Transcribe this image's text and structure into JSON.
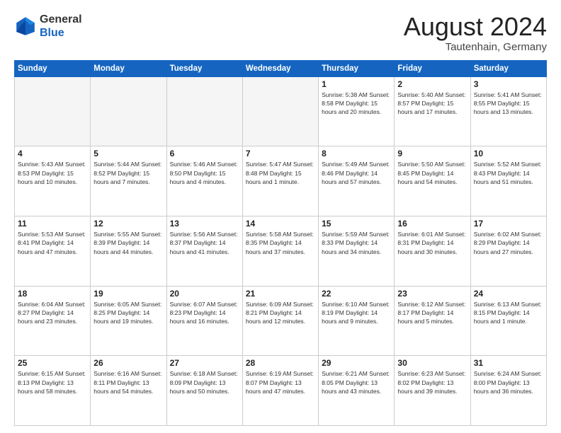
{
  "header": {
    "logo_general": "General",
    "logo_blue": "Blue",
    "title": "August 2024",
    "location": "Tautenhain, Germany"
  },
  "days_of_week": [
    "Sunday",
    "Monday",
    "Tuesday",
    "Wednesday",
    "Thursday",
    "Friday",
    "Saturday"
  ],
  "weeks": [
    [
      {
        "day": "",
        "info": ""
      },
      {
        "day": "",
        "info": ""
      },
      {
        "day": "",
        "info": ""
      },
      {
        "day": "",
        "info": ""
      },
      {
        "day": "1",
        "info": "Sunrise: 5:38 AM\nSunset: 8:58 PM\nDaylight: 15 hours\nand 20 minutes."
      },
      {
        "day": "2",
        "info": "Sunrise: 5:40 AM\nSunset: 8:57 PM\nDaylight: 15 hours\nand 17 minutes."
      },
      {
        "day": "3",
        "info": "Sunrise: 5:41 AM\nSunset: 8:55 PM\nDaylight: 15 hours\nand 13 minutes."
      }
    ],
    [
      {
        "day": "4",
        "info": "Sunrise: 5:43 AM\nSunset: 8:53 PM\nDaylight: 15 hours\nand 10 minutes."
      },
      {
        "day": "5",
        "info": "Sunrise: 5:44 AM\nSunset: 8:52 PM\nDaylight: 15 hours\nand 7 minutes."
      },
      {
        "day": "6",
        "info": "Sunrise: 5:46 AM\nSunset: 8:50 PM\nDaylight: 15 hours\nand 4 minutes."
      },
      {
        "day": "7",
        "info": "Sunrise: 5:47 AM\nSunset: 8:48 PM\nDaylight: 15 hours\nand 1 minute."
      },
      {
        "day": "8",
        "info": "Sunrise: 5:49 AM\nSunset: 8:46 PM\nDaylight: 14 hours\nand 57 minutes."
      },
      {
        "day": "9",
        "info": "Sunrise: 5:50 AM\nSunset: 8:45 PM\nDaylight: 14 hours\nand 54 minutes."
      },
      {
        "day": "10",
        "info": "Sunrise: 5:52 AM\nSunset: 8:43 PM\nDaylight: 14 hours\nand 51 minutes."
      }
    ],
    [
      {
        "day": "11",
        "info": "Sunrise: 5:53 AM\nSunset: 8:41 PM\nDaylight: 14 hours\nand 47 minutes."
      },
      {
        "day": "12",
        "info": "Sunrise: 5:55 AM\nSunset: 8:39 PM\nDaylight: 14 hours\nand 44 minutes."
      },
      {
        "day": "13",
        "info": "Sunrise: 5:56 AM\nSunset: 8:37 PM\nDaylight: 14 hours\nand 41 minutes."
      },
      {
        "day": "14",
        "info": "Sunrise: 5:58 AM\nSunset: 8:35 PM\nDaylight: 14 hours\nand 37 minutes."
      },
      {
        "day": "15",
        "info": "Sunrise: 5:59 AM\nSunset: 8:33 PM\nDaylight: 14 hours\nand 34 minutes."
      },
      {
        "day": "16",
        "info": "Sunrise: 6:01 AM\nSunset: 8:31 PM\nDaylight: 14 hours\nand 30 minutes."
      },
      {
        "day": "17",
        "info": "Sunrise: 6:02 AM\nSunset: 8:29 PM\nDaylight: 14 hours\nand 27 minutes."
      }
    ],
    [
      {
        "day": "18",
        "info": "Sunrise: 6:04 AM\nSunset: 8:27 PM\nDaylight: 14 hours\nand 23 minutes."
      },
      {
        "day": "19",
        "info": "Sunrise: 6:05 AM\nSunset: 8:25 PM\nDaylight: 14 hours\nand 19 minutes."
      },
      {
        "day": "20",
        "info": "Sunrise: 6:07 AM\nSunset: 8:23 PM\nDaylight: 14 hours\nand 16 minutes."
      },
      {
        "day": "21",
        "info": "Sunrise: 6:09 AM\nSunset: 8:21 PM\nDaylight: 14 hours\nand 12 minutes."
      },
      {
        "day": "22",
        "info": "Sunrise: 6:10 AM\nSunset: 8:19 PM\nDaylight: 14 hours\nand 9 minutes."
      },
      {
        "day": "23",
        "info": "Sunrise: 6:12 AM\nSunset: 8:17 PM\nDaylight: 14 hours\nand 5 minutes."
      },
      {
        "day": "24",
        "info": "Sunrise: 6:13 AM\nSunset: 8:15 PM\nDaylight: 14 hours\nand 1 minute."
      }
    ],
    [
      {
        "day": "25",
        "info": "Sunrise: 6:15 AM\nSunset: 8:13 PM\nDaylight: 13 hours\nand 58 minutes."
      },
      {
        "day": "26",
        "info": "Sunrise: 6:16 AM\nSunset: 8:11 PM\nDaylight: 13 hours\nand 54 minutes."
      },
      {
        "day": "27",
        "info": "Sunrise: 6:18 AM\nSunset: 8:09 PM\nDaylight: 13 hours\nand 50 minutes."
      },
      {
        "day": "28",
        "info": "Sunrise: 6:19 AM\nSunset: 8:07 PM\nDaylight: 13 hours\nand 47 minutes."
      },
      {
        "day": "29",
        "info": "Sunrise: 6:21 AM\nSunset: 8:05 PM\nDaylight: 13 hours\nand 43 minutes."
      },
      {
        "day": "30",
        "info": "Sunrise: 6:23 AM\nSunset: 8:02 PM\nDaylight: 13 hours\nand 39 minutes."
      },
      {
        "day": "31",
        "info": "Sunrise: 6:24 AM\nSunset: 8:00 PM\nDaylight: 13 hours\nand 36 minutes."
      }
    ]
  ]
}
